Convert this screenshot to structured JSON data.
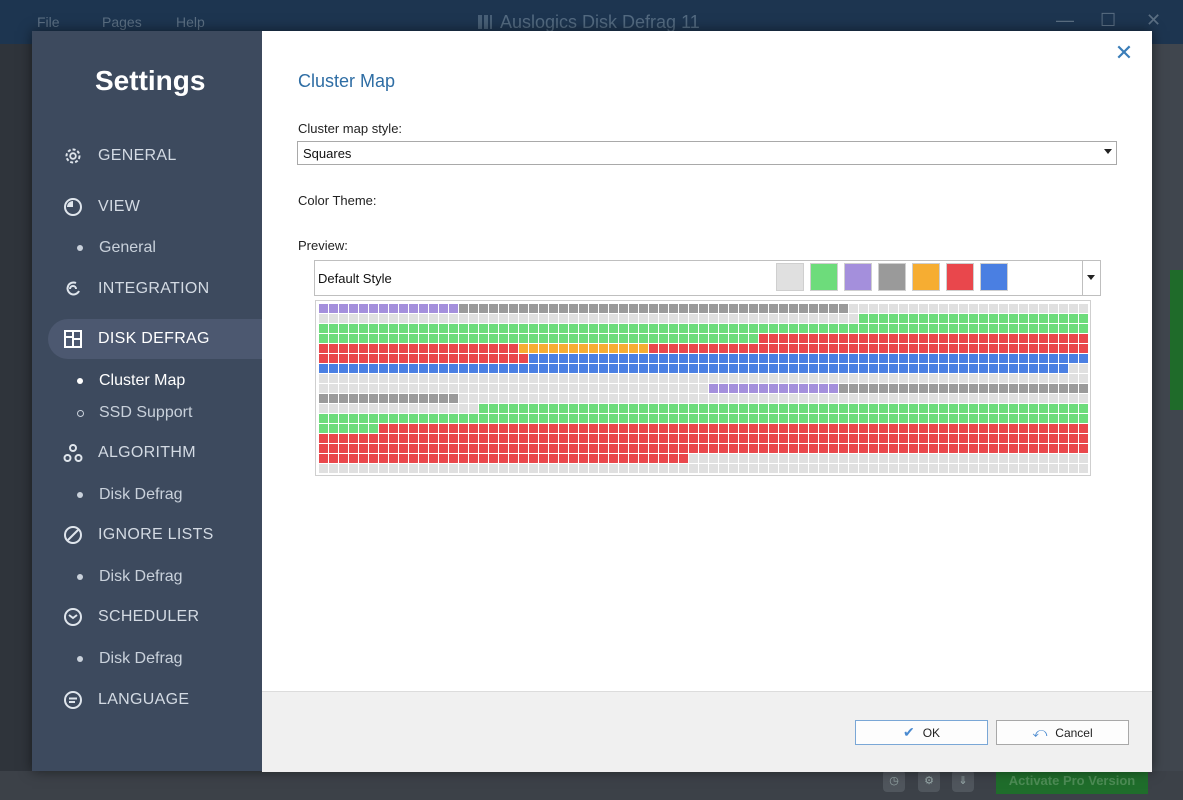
{
  "background_app": {
    "menu": [
      "File",
      "Pages",
      "Help"
    ],
    "title": "Auslogics Disk Defrag 11",
    "activate_label": "Activate Pro Version"
  },
  "dialog": {
    "sidebar_title": "Settings",
    "nav": [
      {
        "label": "GENERAL",
        "icon": "gear-icon"
      },
      {
        "label": "VIEW",
        "icon": "eye-icon",
        "subs": [
          "General"
        ]
      },
      {
        "label": "INTEGRATION",
        "icon": "link-icon"
      },
      {
        "label": "DISK DEFRAG",
        "icon": "disk-defrag-icon",
        "selected": true,
        "subs": [
          "Cluster Map",
          "SSD Support"
        ]
      },
      {
        "label": "ALGORITHM",
        "icon": "algorithm-icon",
        "subs": [
          "Disk Defrag"
        ]
      },
      {
        "label": "IGNORE LISTS",
        "icon": "block-icon",
        "subs": [
          "Disk Defrag"
        ]
      },
      {
        "label": "SCHEDULER",
        "icon": "clock-icon",
        "subs": [
          "Disk Defrag"
        ]
      },
      {
        "label": "LANGUAGE",
        "icon": "language-icon"
      }
    ],
    "page_title": "Cluster Map",
    "cluster_style_label": "Cluster map style:",
    "cluster_style_value": "Squares",
    "color_theme_label": "Color Theme:",
    "preview_label": "Preview:",
    "theme_value": "Default Style",
    "theme_colors": [
      "#e0e0e0",
      "#6ddc7b",
      "#a48fdc",
      "#9a9a9a",
      "#f6ad32",
      "#e9474c",
      "#4a7fe2"
    ],
    "ok_label": "OK",
    "cancel_label": "Cancel"
  },
  "map_colors": {
    "empty": "#e0e0e0",
    "green": "#6ddc7b",
    "purple": "#a48fdc",
    "gray": "#9a9a9a",
    "orange": "#f6ad32",
    "red": "#e9474c",
    "blue": "#4a7fe2"
  }
}
